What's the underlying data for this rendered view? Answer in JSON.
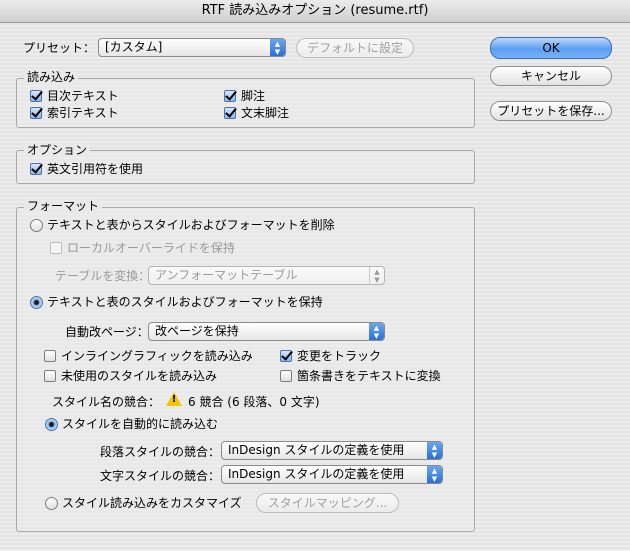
{
  "window": {
    "title": "RTF 読み込みオプション (resume.rtf)"
  },
  "preset": {
    "label": "プリセット：",
    "value": "[カスタム]",
    "default_button": "デフォルトに設定"
  },
  "buttons": {
    "ok": "OK",
    "cancel": "キャンセル",
    "save_preset": "プリセットを保存..."
  },
  "import_group": {
    "title": "読み込み",
    "items": [
      {
        "label": "目次テキスト",
        "checked": true
      },
      {
        "label": "索引テキスト",
        "checked": true
      },
      {
        "label": "脚注",
        "checked": true
      },
      {
        "label": "文末脚注",
        "checked": true
      }
    ]
  },
  "options_group": {
    "title": "オプション",
    "items": [
      {
        "label": "英文引用符を使用",
        "checked": true
      }
    ]
  },
  "format_group": {
    "title": "フォーマット",
    "remove_radio": "テキストと表からスタイルおよびフォーマットを削除",
    "local_override": "ローカルオーバーライドを保持",
    "convert_table_label": "テーブルを変換：",
    "convert_table_value": "アンフォーマットテーブル",
    "keep_radio": "テキストと表のスタイルおよびフォーマットを保持",
    "page_break_label": "自動改ページ：",
    "page_break_value": "改ページを保持",
    "inline_graphics": "インライングラフィックを読み込み",
    "unused_styles": "未使用のスタイルを読み込み",
    "track_changes": "変更をトラック",
    "bullets_to_text": "箇条書きをテキストに変換",
    "style_conflict_label": "スタイル名の競合：",
    "style_conflict_value": "6 競合 (6 段落、0 文字)",
    "auto_import_radio": "スタイルを自動的に読み込む",
    "para_conflict_label": "段落スタイルの競合：",
    "para_conflict_value": "InDesign スタイルの定義を使用",
    "char_conflict_label": "文字スタイルの競合：",
    "char_conflict_value": "InDesign スタイルの定義を使用",
    "customize_radio": "スタイル読み込みをカスタマイズ",
    "style_mapping_button": "スタイルマッピング..."
  },
  "colors": {
    "accent": "#3d84e6",
    "warning": "#f2c600"
  }
}
